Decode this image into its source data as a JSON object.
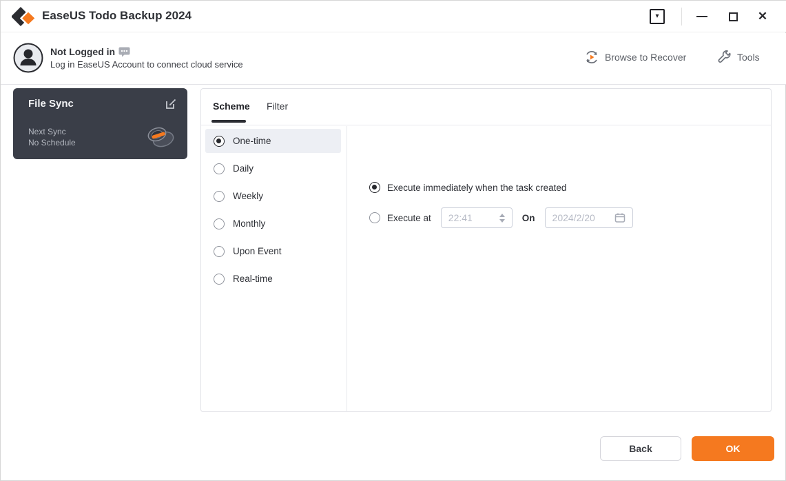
{
  "window": {
    "title": "EaseUS Todo Backup 2024",
    "tray_arrow_glyph": "▾",
    "close_glyph": "✕"
  },
  "account": {
    "status": "Not Logged in",
    "subtitle": "Log in EaseUS Account to connect cloud service"
  },
  "header_actions": {
    "browse_to_recover": "Browse to Recover",
    "tools": "Tools"
  },
  "sync_card": {
    "title": "File Sync",
    "next_sync_label": "Next Sync",
    "schedule_value": "No Schedule"
  },
  "tabs": [
    {
      "label": "Scheme",
      "active": true
    },
    {
      "label": "Filter",
      "active": false
    }
  ],
  "schedule": {
    "options": [
      {
        "label": "One-time",
        "selected": true
      },
      {
        "label": "Daily",
        "selected": false
      },
      {
        "label": "Weekly",
        "selected": false
      },
      {
        "label": "Monthly",
        "selected": false
      },
      {
        "label": "Upon Event",
        "selected": false
      },
      {
        "label": "Real-time",
        "selected": false
      }
    ]
  },
  "execute": {
    "immediate_label": "Execute immediately when the task created",
    "immediate_selected": true,
    "at_label": "Execute at",
    "at_selected": false,
    "time_value": "22:41",
    "on_label": "On",
    "date_value": "2024/2/20"
  },
  "footer": {
    "back_label": "Back",
    "ok_label": "OK"
  },
  "colors": {
    "accent_orange": "#f5791f",
    "card_dark": "#3a3e48",
    "selected_row": "#edeff4",
    "input_border": "#ccd0da",
    "disabled_text": "#b7bbc6"
  }
}
